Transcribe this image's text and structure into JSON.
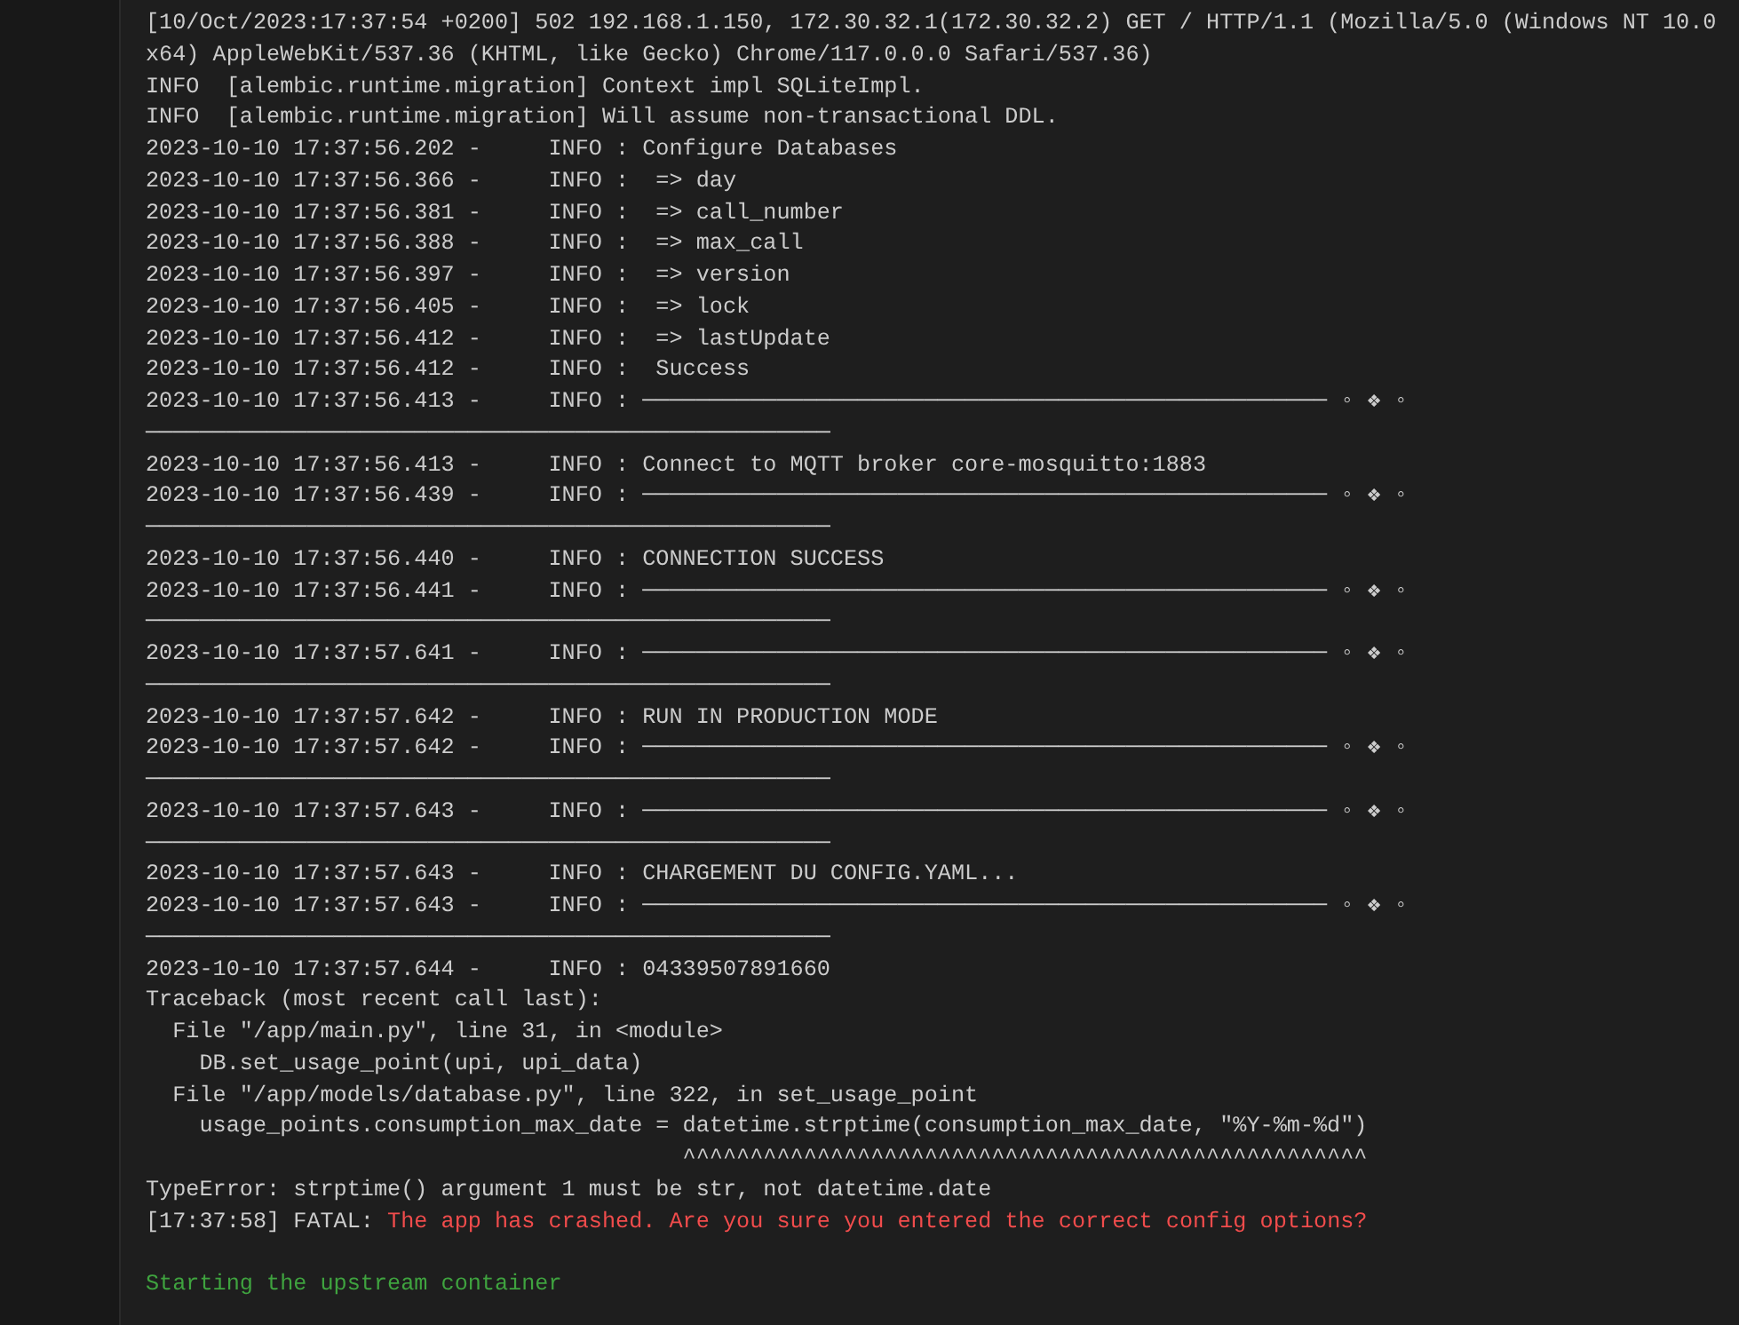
{
  "log": [
    {
      "kind": "plain",
      "text": "[10/Oct/2023:17:37:54 +0200] 502 192.168.1.150, 172.30.32.1(172.30.32.2) GET / HTTP/1.1 (Mozilla/5.0 (Windows NT 10.0"
    },
    {
      "kind": "plain",
      "text": "x64) AppleWebKit/537.36 (KHTML, like Gecko) Chrome/117.0.0.0 Safari/537.36)"
    },
    {
      "kind": "plain",
      "text": "INFO  [alembic.runtime.migration] Context impl SQLiteImpl."
    },
    {
      "kind": "plain",
      "text": "INFO  [alembic.runtime.migration] Will assume non-transactional DDL."
    },
    {
      "kind": "plain",
      "text": "2023-10-10 17:37:56.202 -     INFO : Configure Databases"
    },
    {
      "kind": "plain",
      "text": "2023-10-10 17:37:56.366 -     INFO :  => day"
    },
    {
      "kind": "plain",
      "text": "2023-10-10 17:37:56.381 -     INFO :  => call_number"
    },
    {
      "kind": "plain",
      "text": "2023-10-10 17:37:56.388 -     INFO :  => max_call"
    },
    {
      "kind": "plain",
      "text": "2023-10-10 17:37:56.397 -     INFO :  => version"
    },
    {
      "kind": "plain",
      "text": "2023-10-10 17:37:56.405 -     INFO :  => lock"
    },
    {
      "kind": "plain",
      "text": "2023-10-10 17:37:56.412 -     INFO :  => lastUpdate"
    },
    {
      "kind": "plain",
      "text": "2023-10-10 17:37:56.412 -     INFO :  Success"
    },
    {
      "kind": "plain",
      "text": "2023-10-10 17:37:56.413 -     INFO : ─────────────────────────────────────────────────── ◦ ❖ ◦"
    },
    {
      "kind": "plain",
      "text": "───────────────────────────────────────────────────"
    },
    {
      "kind": "plain",
      "text": "2023-10-10 17:37:56.413 -     INFO : Connect to MQTT broker core-mosquitto:1883"
    },
    {
      "kind": "plain",
      "text": "2023-10-10 17:37:56.439 -     INFO : ─────────────────────────────────────────────────── ◦ ❖ ◦"
    },
    {
      "kind": "plain",
      "text": "───────────────────────────────────────────────────"
    },
    {
      "kind": "plain",
      "text": "2023-10-10 17:37:56.440 -     INFO : CONNECTION SUCCESS"
    },
    {
      "kind": "plain",
      "text": "2023-10-10 17:37:56.441 -     INFO : ─────────────────────────────────────────────────── ◦ ❖ ◦"
    },
    {
      "kind": "plain",
      "text": "───────────────────────────────────────────────────"
    },
    {
      "kind": "plain",
      "text": "2023-10-10 17:37:57.641 -     INFO : ─────────────────────────────────────────────────── ◦ ❖ ◦"
    },
    {
      "kind": "plain",
      "text": "───────────────────────────────────────────────────"
    },
    {
      "kind": "plain",
      "text": "2023-10-10 17:37:57.642 -     INFO : RUN IN PRODUCTION MODE"
    },
    {
      "kind": "plain",
      "text": "2023-10-10 17:37:57.642 -     INFO : ─────────────────────────────────────────────────── ◦ ❖ ◦"
    },
    {
      "kind": "plain",
      "text": "───────────────────────────────────────────────────"
    },
    {
      "kind": "plain",
      "text": "2023-10-10 17:37:57.643 -     INFO : ─────────────────────────────────────────────────── ◦ ❖ ◦"
    },
    {
      "kind": "plain",
      "text": "───────────────────────────────────────────────────"
    },
    {
      "kind": "plain",
      "text": "2023-10-10 17:37:57.643 -     INFO : CHARGEMENT DU CONFIG.YAML..."
    },
    {
      "kind": "plain",
      "text": "2023-10-10 17:37:57.643 -     INFO : ─────────────────────────────────────────────────── ◦ ❖ ◦"
    },
    {
      "kind": "plain",
      "text": "───────────────────────────────────────────────────"
    },
    {
      "kind": "plain",
      "text": "2023-10-10 17:37:57.644 -     INFO : 04339507891660"
    },
    {
      "kind": "plain",
      "text": "Traceback (most recent call last):"
    },
    {
      "kind": "plain",
      "text": "  File \"/app/main.py\", line 31, in <module>"
    },
    {
      "kind": "plain",
      "text": "    DB.set_usage_point(upi, upi_data)"
    },
    {
      "kind": "plain",
      "text": "  File \"/app/models/database.py\", line 322, in set_usage_point"
    },
    {
      "kind": "plain",
      "text": "    usage_points.consumption_max_date = datetime.strptime(consumption_max_date, \"%Y-%m-%d\")"
    },
    {
      "kind": "plain",
      "text": "                                        ^^^^^^^^^^^^^^^^^^^^^^^^^^^^^^^^^^^^^^^^^^^^^^^^^^^"
    },
    {
      "kind": "plain",
      "text": "TypeError: strptime() argument 1 must be str, not datetime.date"
    },
    {
      "kind": "fatal",
      "prefix": "[17:37:58] FATAL:",
      "message": "The app has crashed. Are you sure you entered the correct config options?"
    },
    {
      "kind": "blank"
    },
    {
      "kind": "success",
      "text": "Starting the upstream container"
    }
  ]
}
